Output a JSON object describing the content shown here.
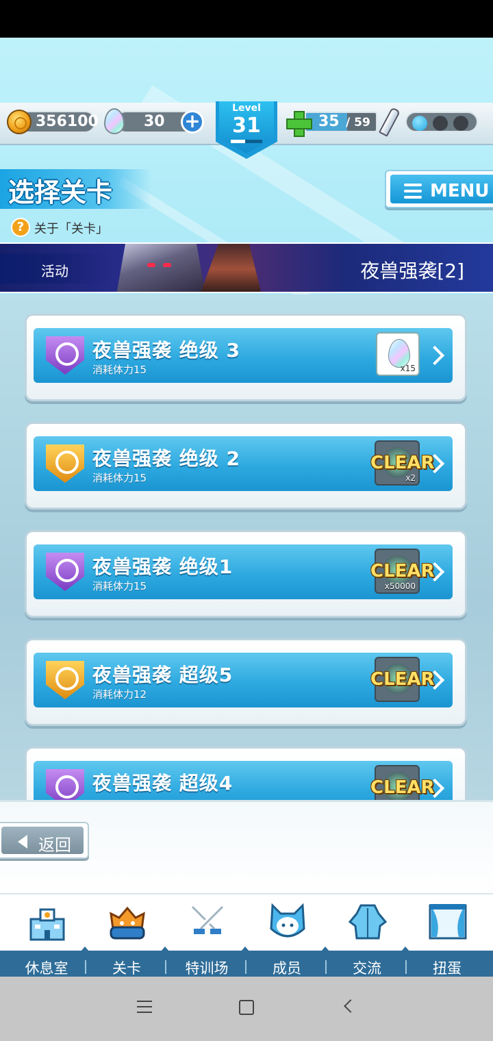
{
  "resources": {
    "coins": "356100",
    "gems": "30",
    "level_label": "Level",
    "level": "31",
    "level_progress": 0.45,
    "stamina_current": "35",
    "stamina_max": "/ 59",
    "stamina_fraction": 0.59,
    "orbs_filled": 1,
    "orbs_total": 3
  },
  "header": {
    "title": "选择关卡",
    "about_icon": "?",
    "about_text": "关于「关卡」",
    "menu_label": "MENU"
  },
  "event": {
    "tag": "活动",
    "title": "夜兽强袭[2]"
  },
  "stages": [
    {
      "title": "夜兽强袭  绝级  3",
      "cost": "消耗体力15",
      "shield": "purple",
      "reward": "gem",
      "reward_qty": "x15",
      "cleared": false
    },
    {
      "title": "夜兽强袭  绝级  2",
      "cost": "消耗体力15",
      "shield": "gold",
      "reward": "item",
      "reward_qty": "x2",
      "cleared": true,
      "clear_label": "CLEAR"
    },
    {
      "title": "夜兽强袭  绝级1",
      "cost": "消耗体力15",
      "shield": "purple",
      "reward": "item",
      "reward_qty": "x50000",
      "cleared": true,
      "clear_label": "CLEAR"
    },
    {
      "title": "夜兽强袭  超级5",
      "cost": "消耗体力12",
      "shield": "gold",
      "reward": "item",
      "reward_qty": "",
      "cleared": true,
      "clear_label": "CLEAR"
    },
    {
      "title": "夜兽强袭  超级4",
      "cost": "",
      "shield": "purple",
      "reward": "item",
      "reward_qty": "",
      "cleared": true,
      "clear_label": "CLEAR"
    }
  ],
  "back_label": "返回",
  "nav": [
    {
      "label": "休息室",
      "icon": "school-building-icon"
    },
    {
      "label": "关卡",
      "icon": "monster-icon"
    },
    {
      "label": "特训场",
      "icon": "crossed-swords-icon"
    },
    {
      "label": "成员",
      "icon": "cat-girl-icon"
    },
    {
      "label": "交流",
      "icon": "dress-icon"
    },
    {
      "label": "扭蛋",
      "icon": "curtain-icon"
    }
  ],
  "colors": {
    "accent": "#1a9ad8",
    "nav_bar": "#2f6d98",
    "clear_gold": "#ffe066"
  }
}
